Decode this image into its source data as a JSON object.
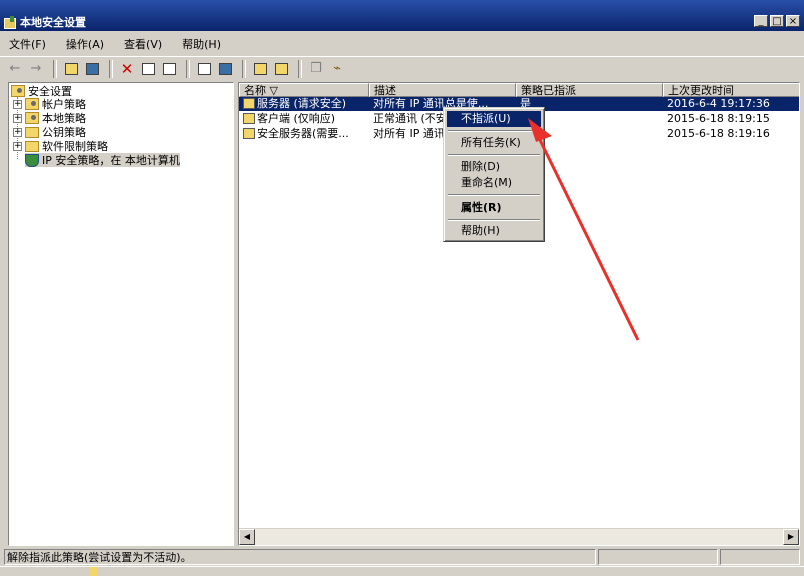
{
  "window": {
    "title": "本地安全设置",
    "controls": [
      "_",
      "□",
      "×"
    ]
  },
  "menu": [
    "文件(F)",
    "操作(A)",
    "查看(V)",
    "帮助(H)"
  ],
  "tree": [
    {
      "label": "安全设置",
      "expander": ""
    },
    {
      "label": "帐户策略",
      "expander": "+"
    },
    {
      "label": "本地策略",
      "expander": "+"
    },
    {
      "label": "公钥策略",
      "expander": "+"
    },
    {
      "label": "软件限制策略",
      "expander": "+"
    },
    {
      "label": "IP 安全策略，在 本地计算机",
      "expander": ""
    }
  ],
  "list": {
    "headers": [
      "名称 ▽",
      "描述",
      "策略已指派",
      "上次更改时间"
    ],
    "rows": [
      {
        "name": "服务器 (请求安全)",
        "desc": "对所有 IP 通讯总是使...",
        "assigned": "是",
        "modified": "2016-6-4 19:17:36"
      },
      {
        "name": "客户端 (仅响应)",
        "desc": "正常通讯 (不安全)...",
        "assigned": "",
        "modified": "2015-6-18 8:19:15"
      },
      {
        "name": "安全服务器(需要...",
        "desc": "对所有 IP 通讯...",
        "assigned": "",
        "modified": "2015-6-18 8:19:16"
      }
    ]
  },
  "context_menu": {
    "unassign": "不指派(U)",
    "all_tasks": "所有任务(K)",
    "delete": "删除(D)",
    "rename": "重命名(M)",
    "properties": "属性(R)",
    "help": "帮助(H)"
  },
  "status": {
    "text": "解除指派此策略(尝试设置为不活动)。"
  },
  "annotation_color": "#e8312a"
}
